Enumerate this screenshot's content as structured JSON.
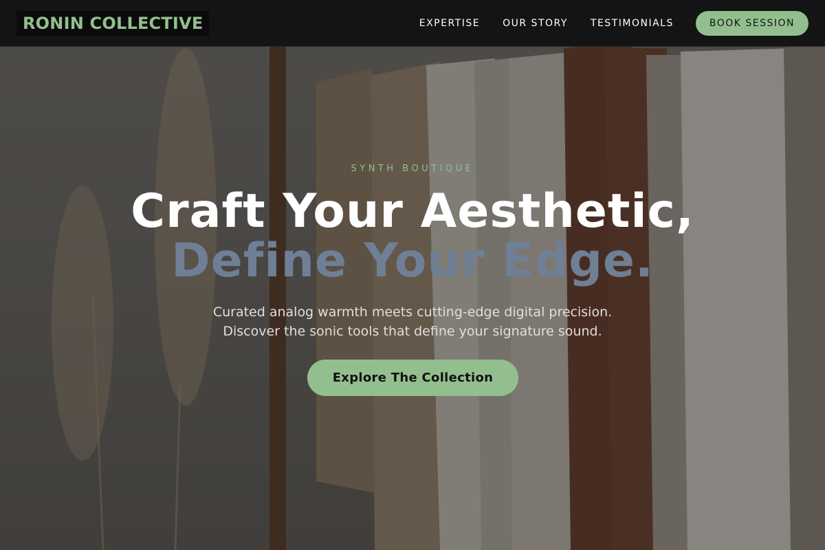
{
  "colors": {
    "accent": "#93bf8f",
    "headline_secondary": "#6f7f95",
    "nav_bg": "#141414"
  },
  "nav": {
    "brand": "RONIN COLLECTIVE",
    "links": [
      "EXPERTISE",
      "OUR STORY",
      "TESTIMONIALS"
    ],
    "cta_label": "BOOK SESSION"
  },
  "hero": {
    "eyebrow": "SYNTH BOUTIQUE",
    "headline_line1": "Craft Your Aesthetic,",
    "headline_line2": "Define Your Edge.",
    "subtext_line1": "Curated analog warmth meets cutting-edge digital precision.",
    "subtext_line2": "Discover the sonic tools that define your signature sound.",
    "cta_label": "Explore The Collection"
  }
}
